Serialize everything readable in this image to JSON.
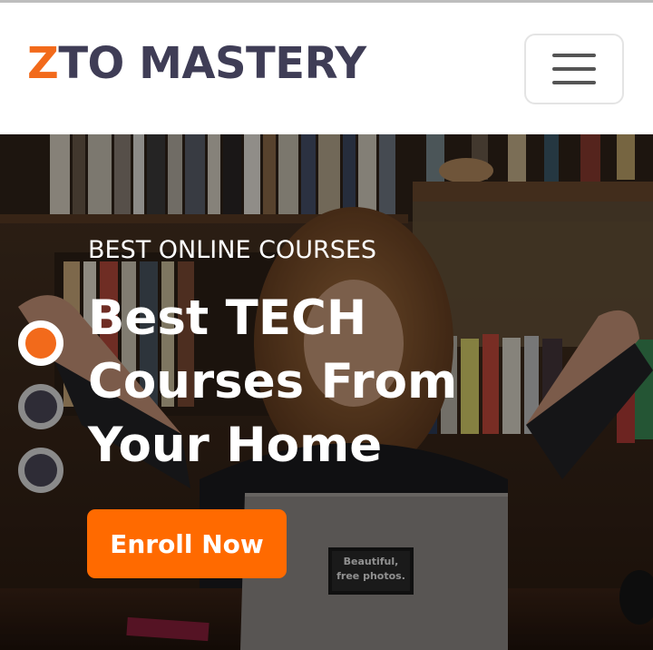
{
  "brand": {
    "accent_letter": "Z",
    "rest": "TO MASTERY",
    "accent_color": "#f26a1b",
    "text_color": "#3f3d56"
  },
  "nav": {
    "menu_icon": "hamburger-icon"
  },
  "hero": {
    "eyebrow": "BEST ONLINE COURSES",
    "headline_lines": [
      "Best TECH",
      "Courses From",
      "Your Home"
    ],
    "cta_label": "Enroll Now",
    "cta_color": "#ff6a00",
    "slides": {
      "count": 3,
      "active_index": 0
    },
    "laptop_sticker_line1": "Beautiful,",
    "laptop_sticker_line2": "free photos."
  }
}
